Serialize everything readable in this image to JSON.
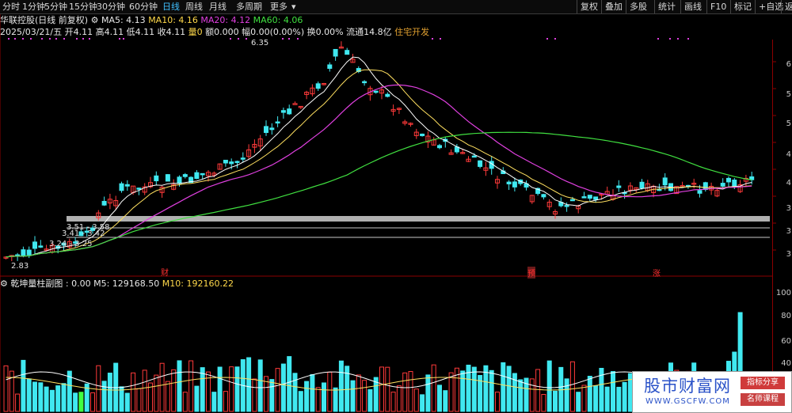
{
  "toolbar": {
    "tabs": [
      "分时",
      "1分钟",
      "5分钟",
      "15分钟",
      "30分钟",
      "60分钟",
      "日线",
      "周线",
      "月线",
      "多周期",
      "更多"
    ],
    "active_tab": "日线",
    "right_buttons": [
      "复权",
      "叠加",
      "多股",
      "统计",
      "画线",
      "F10",
      "标记",
      "+自选",
      "返"
    ]
  },
  "info": {
    "stock_name": "华联控股(日线 前复权)",
    "ma5_label": "MA5: 4.13",
    "ma10_label": "MA10: 4.16",
    "ma20_label": "MA20: 4.12",
    "ma60_label": "MA60: 4.06",
    "date": "2025/03/21/五",
    "open": "开4.11",
    "high": "高4.11",
    "low": "低4.11",
    "close": "收4.11",
    "vol": "量0",
    "amount": "额0.000",
    "amp": "幅0.00(0.00%)",
    "turnover": "换0.00%",
    "float": "流通14.8亿",
    "sector": "住宅开发"
  },
  "price_axis": [
    "6",
    "5",
    "5",
    "4",
    "4",
    "3",
    "3",
    "3"
  ],
  "volume_axis": [
    "100",
    "80",
    "60",
    "40"
  ],
  "markers": {
    "m1": "财",
    "m2": "预",
    "m3": "涨"
  },
  "annotations": {
    "high": "6.35",
    "low": "2.83",
    "s1": "3.51 - 3.58",
    "s2": "3.41 - 3.42",
    "s3": "3.24 - 3.25"
  },
  "volume_header": {
    "name": "乾坤量柱副图",
    "v0": ": 0.00",
    "m5": "M5: 129168.50",
    "m10": "M10: 192160.22"
  },
  "watermark": {
    "title": "股市财富网",
    "url": "WWW.GSCFW.COM",
    "badge1": "指标分享",
    "badge2": "名师课程"
  },
  "colors": {
    "up": "#ff3a3a",
    "down": "#40e8f0",
    "ma5": "#ffffff",
    "ma10": "#ffe060",
    "ma20": "#e040e0",
    "ma60": "#40e040"
  }
}
